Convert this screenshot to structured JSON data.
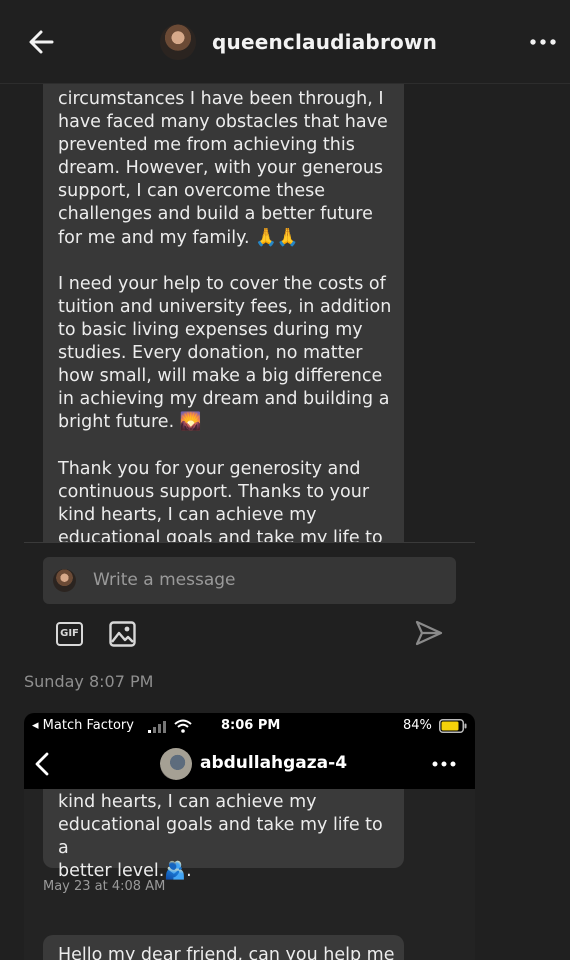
{
  "header": {
    "username": "queenclaudiabrown"
  },
  "message1": {
    "text": "circumstances I have been through, I\nhave faced many obstacles that have\nprevented me from achieving this\ndream. However, with your generous\nsupport, I can overcome these\nchallenges and build a better future\nfor me and my family. 🙏🙏\n\nI need your help to cover the costs of\ntuition and university fees, in addition\nto basic living expenses during my\nstudies. Every donation, no matter\nhow small, will make a big difference\nin achieving my dream and building a\nbright future. 🌄\n\nThank you for your generosity and\ncontinuous support. Thanks to your\nkind hearts, I can achieve my\neducational goals and take my life to a"
  },
  "composer": {
    "placeholder": "Write a message",
    "gif_label": "GIF"
  },
  "timestamp": "Sunday 8:07 PM",
  "embedded_screenshot": {
    "status_bar": {
      "carrier": "◂ Match Factory",
      "time": "8:06 PM",
      "battery": "84%"
    },
    "username": "abdullahgaza-4",
    "message_tail": "kind hearts, I can achieve my\neducational goals and take my life to a\nbetter level.🫂.",
    "message_timestamp": "May 23 at 4:08 AM",
    "next_message": "Hello my dear friend, can you help me"
  },
  "colors": {
    "background": "#202020",
    "bubble": "#383838",
    "battery_fill": "#f5d20a"
  }
}
